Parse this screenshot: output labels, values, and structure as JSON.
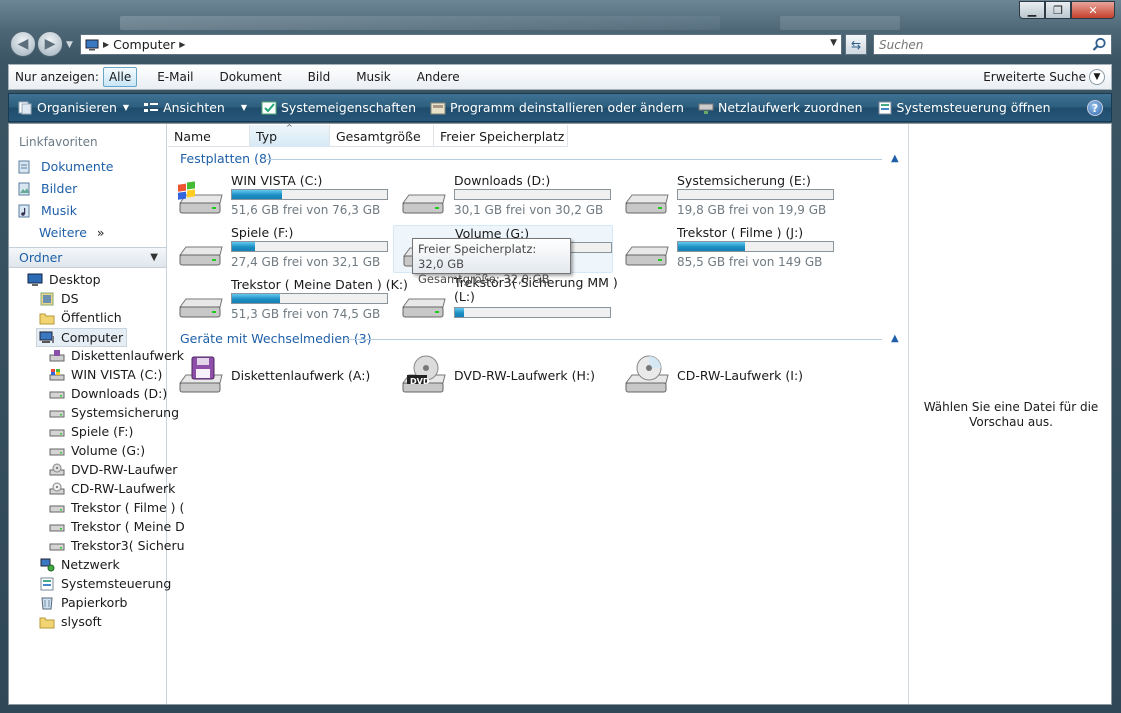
{
  "window": {
    "controls": {
      "minimize": "▁",
      "maximize": "❐",
      "close": "✕"
    }
  },
  "address": {
    "crumb": "Computer"
  },
  "search": {
    "placeholder": "Suchen"
  },
  "filter": {
    "label": "Nur anzeigen:",
    "buttons": [
      {
        "label": "Alle",
        "active": true
      },
      {
        "label": "E-Mail"
      },
      {
        "label": "Dokument"
      },
      {
        "label": "Bild"
      },
      {
        "label": "Musik"
      },
      {
        "label": "Andere"
      }
    ],
    "advanced": "Erweiterte Suche"
  },
  "commands": [
    {
      "label": "Organisieren",
      "icon": "organize-icon",
      "dropdown": true
    },
    {
      "label": "Ansichten",
      "icon": "views-icon",
      "dropdown": true
    },
    {
      "label": "Systemeigenschaften",
      "icon": "system-properties-icon"
    },
    {
      "label": "Programm deinstallieren oder ändern",
      "icon": "uninstall-icon"
    },
    {
      "label": "Netzlaufwerk zuordnen",
      "icon": "map-drive-icon"
    },
    {
      "label": "Systemsteuerung öffnen",
      "icon": "control-panel-icon"
    }
  ],
  "help": "?",
  "sidebar": {
    "favorites_heading": "Linkfavoriten",
    "favorites": [
      {
        "label": "Dokumente",
        "icon": "documents-icon"
      },
      {
        "label": "Bilder",
        "icon": "pictures-icon"
      },
      {
        "label": "Musik",
        "icon": "music-icon"
      }
    ],
    "more": "Weitere",
    "more_chevron": "»",
    "folders_heading": "Ordner"
  },
  "tree": [
    {
      "label": "Desktop",
      "icon": "desktop-icon"
    },
    {
      "label": "DS",
      "icon": "user-folder-icon"
    },
    {
      "label": "Öffentlich",
      "icon": "folder-icon"
    },
    {
      "label": "Computer",
      "icon": "computer-icon",
      "selected": true
    },
    {
      "label": "Diskettenlaufwerk",
      "icon": "floppy-icon"
    },
    {
      "label": "WIN VISTA (C:)",
      "icon": "windows-drive-icon"
    },
    {
      "label": "Downloads (D:)",
      "icon": "hard-drive-icon"
    },
    {
      "label": "Systemsicherung",
      "icon": "hard-drive-icon"
    },
    {
      "label": "Spiele (F:)",
      "icon": "hard-drive-icon"
    },
    {
      "label": "Volume (G:)",
      "icon": "hard-drive-icon"
    },
    {
      "label": "DVD-RW-Laufwer",
      "icon": "dvd-drive-icon"
    },
    {
      "label": "CD-RW-Laufwerk",
      "icon": "cd-drive-icon"
    },
    {
      "label": "Trekstor ( Filme ) (",
      "icon": "hard-drive-icon"
    },
    {
      "label": "Trekstor ( Meine D",
      "icon": "hard-drive-icon"
    },
    {
      "label": "Trekstor3( Sicheru",
      "icon": "hard-drive-icon"
    },
    {
      "label": "Netzwerk",
      "icon": "network-icon"
    },
    {
      "label": "Systemsteuerung",
      "icon": "control-panel-icon"
    },
    {
      "label": "Papierkorb",
      "icon": "recycle-bin-icon"
    },
    {
      "label": "slysoft",
      "icon": "folder-icon"
    }
  ],
  "columns": [
    {
      "label": "Name"
    },
    {
      "label": "Typ",
      "sorted": true,
      "sort_indicator": "^"
    },
    {
      "label": "Gesamtgröße"
    },
    {
      "label": "Freier Speicherplatz"
    }
  ],
  "groups": {
    "hard_disks": "Festplatten (8)",
    "removable": "Geräte mit Wechselmedien (3)",
    "collapse_glyph": "▲"
  },
  "drives": [
    {
      "name": "WIN VISTA (C:)",
      "free": "51,6 GB frei von 76,3 GB",
      "used_fraction": 0.32,
      "icon": "windows-drive-icon"
    },
    {
      "name": "Downloads (D:)",
      "free": "30,1 GB frei von 30,2 GB",
      "used_fraction": 0.0,
      "icon": "hard-drive-icon"
    },
    {
      "name": "Systemsicherung (E:)",
      "free": "19,8 GB frei von 19,9 GB",
      "used_fraction": 0.0,
      "icon": "hard-drive-icon"
    },
    {
      "name": "Spiele (F:)",
      "free": "27,4 GB frei von 32,1 GB",
      "used_fraction": 0.15,
      "icon": "hard-drive-icon"
    },
    {
      "name": "Volume (G:)",
      "free": "",
      "used_fraction": 0.0,
      "icon": "hard-drive-icon",
      "hover": true
    },
    {
      "name": "Trekstor ( Filme ) (J:)",
      "free": "85,5 GB frei von 149 GB",
      "used_fraction": 0.43,
      "icon": "hard-drive-icon"
    },
    {
      "name": "Trekstor ( Meine Daten ) (K:)",
      "free": "51,3 GB frei von 74,5 GB",
      "used_fraction": 0.31,
      "icon": "hard-drive-icon"
    },
    {
      "name": "Trekstor3( Sicherung MM )\n(L:)",
      "free": "",
      "used_fraction": 0.06,
      "icon": "hard-drive-icon"
    }
  ],
  "devices": [
    {
      "name": "Diskettenlaufwerk (A:)",
      "icon": "floppy-icon"
    },
    {
      "name": "DVD-RW-Laufwerk (H:)",
      "icon": "dvd-drive-icon",
      "badge": "DVD"
    },
    {
      "name": "CD-RW-Laufwerk (I:)",
      "icon": "cd-drive-icon"
    }
  ],
  "tooltip": {
    "line1": "Freier Speicherplatz: 32,0 GB",
    "line2": "Gesamtgröße: 32,0 GB"
  },
  "preview": {
    "message": "Wählen Sie eine Datei für die Vorschau aus."
  },
  "colors": {
    "accent": "#1e5fa8",
    "bar_fill": "#1d8fc3",
    "command_bar": "#2c5d7d"
  }
}
